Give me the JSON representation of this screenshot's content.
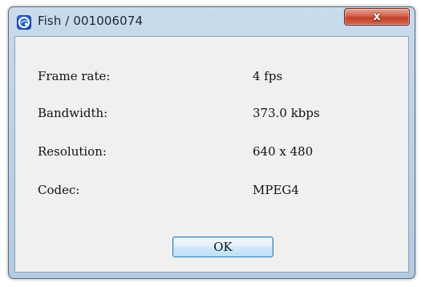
{
  "window": {
    "title": "Fish / 001006074",
    "icon": "app-logo-icon",
    "close_label": "x"
  },
  "info": {
    "rows": [
      {
        "label": "Frame rate:",
        "value": "4 fps"
      },
      {
        "label": "Bandwidth:",
        "value": "373.0 kbps"
      },
      {
        "label": "Resolution:",
        "value": "640 x 480"
      },
      {
        "label": "Codec:",
        "value": "MPEG4"
      }
    ]
  },
  "buttons": {
    "ok_label": "OK"
  },
  "colors": {
    "titlebar": "#bcd3e8",
    "close_button": "#c2402b",
    "client_bg": "#f0f0f0",
    "ok_button": "#cde7f8"
  }
}
